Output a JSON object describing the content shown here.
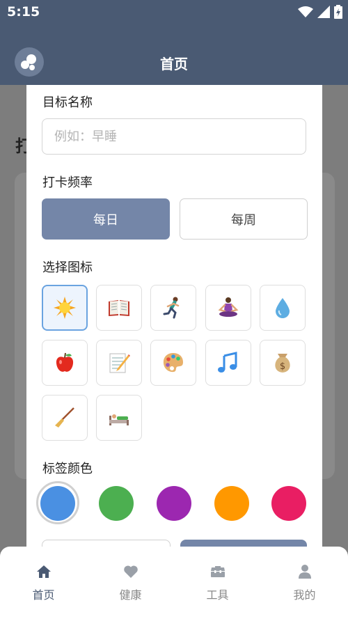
{
  "status_bar": {
    "time": "5:15"
  },
  "app_bar": {
    "title": "首页"
  },
  "background_page": {
    "heading": "打"
  },
  "form": {
    "name_label": "目标名称",
    "name_placeholder": "例如：早睡",
    "name_value": "",
    "frequency_label": "打卡频率",
    "frequency_options": [
      "每日",
      "每周"
    ],
    "frequency_selected": "每日",
    "icon_label": "选择图标",
    "icons": [
      "sun-icon",
      "book-icon",
      "runner-icon",
      "meditation-icon",
      "water-drop-icon",
      "apple-icon",
      "memo-icon",
      "palette-icon",
      "music-note-icon",
      "money-bag-icon",
      "broom-icon",
      "bed-icon"
    ],
    "selected_icon": "sun-icon",
    "color_label": "标签颜色",
    "colors": [
      "#4a90e2",
      "#4caf50",
      "#9c27b0",
      "#ff9800",
      "#e91e63"
    ],
    "selected_color": "#4a90e2"
  },
  "bottom_nav": {
    "items": [
      {
        "label": "首页",
        "icon": "home-icon",
        "active": true
      },
      {
        "label": "健康",
        "icon": "heart-icon",
        "active": false
      },
      {
        "label": "工具",
        "icon": "toolbox-icon",
        "active": false
      },
      {
        "label": "我的",
        "icon": "person-icon",
        "active": false
      }
    ],
    "active_color": "#4a5a73",
    "inactive_color": "#9aa0a8"
  }
}
